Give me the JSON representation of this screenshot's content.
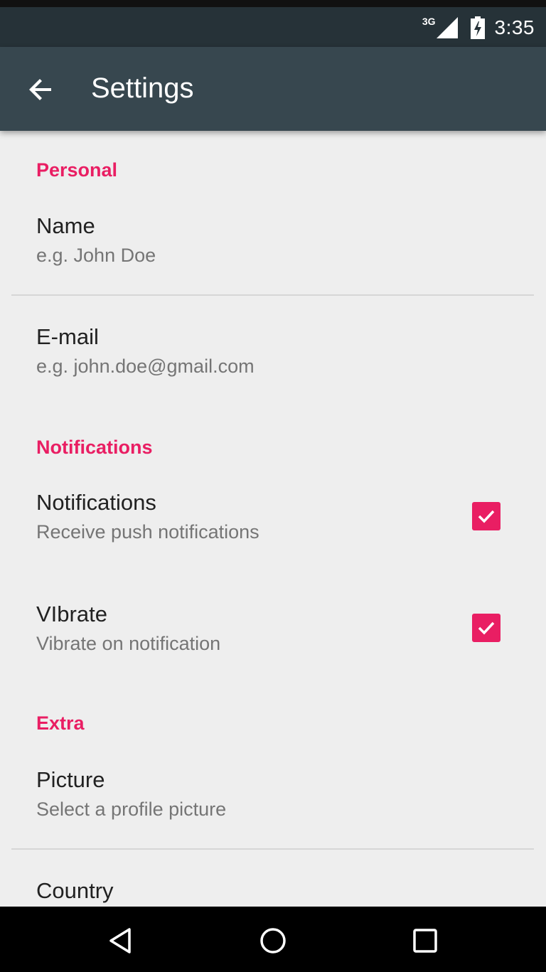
{
  "status_bar": {
    "network": "3G",
    "time": "3:35",
    "icons": [
      "signal-icon",
      "battery-charging-icon"
    ]
  },
  "app_bar": {
    "back_icon": "arrow-back-icon",
    "title": "Settings"
  },
  "sections": {
    "personal": {
      "header": "Personal",
      "name": {
        "title": "Name",
        "summary": "e.g. John Doe"
      },
      "email": {
        "title": "E-mail",
        "summary": "e.g. john.doe@gmail.com"
      }
    },
    "notifications": {
      "header": "Notifications",
      "notifications": {
        "title": "Notifications",
        "summary": "Receive push notifications",
        "checked": true
      },
      "vibrate": {
        "title": "VIbrate",
        "summary": "Vibrate on notification",
        "checked": true
      }
    },
    "extra": {
      "header": "Extra",
      "picture": {
        "title": "Picture",
        "summary": "Select a profile picture"
      },
      "country": {
        "title": "Country"
      }
    }
  },
  "nav_bar": {
    "icons": [
      "back-triangle-icon",
      "home-circle-icon",
      "recents-square-icon"
    ]
  },
  "colors": {
    "accent": "#e91e63",
    "app_bar": "#37474f",
    "status_bar": "#263238",
    "background": "#eeeeee"
  }
}
